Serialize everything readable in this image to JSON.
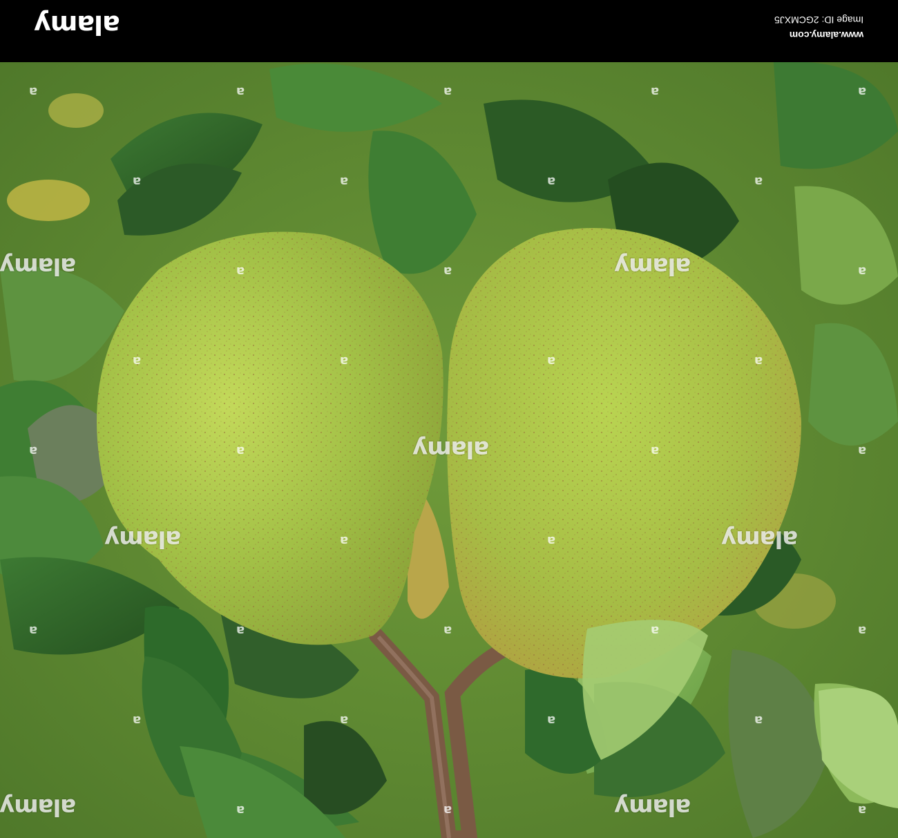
{
  "watermark": {
    "brand": "alamy",
    "site_url": "www.alamy.com",
    "image_id": "Image ID: 2GCMXJ5",
    "tile_text": "alamy",
    "tile_mark": "a"
  },
  "photo": {
    "subject_colors": {
      "pear_skin": "#9dbb3f",
      "pear_highlight": "#c4d85a",
      "pear_blush": "#b49a3c",
      "leaf_dark": "#2f5e2a",
      "leaf_light": "#7aa84a",
      "stem": "#7a5a44"
    }
  }
}
